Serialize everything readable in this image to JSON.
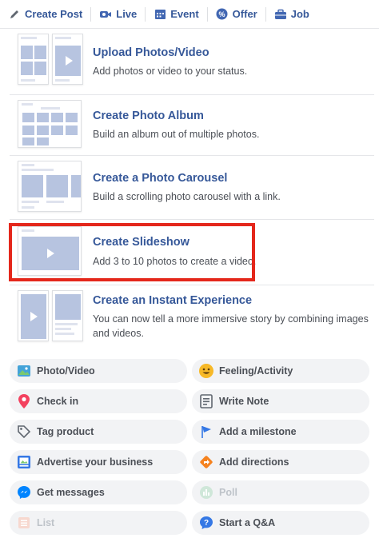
{
  "tabs": [
    {
      "label": "Create Post",
      "icon": "pencil-icon"
    },
    {
      "label": "Live",
      "icon": "video-camera-icon"
    },
    {
      "label": "Event",
      "icon": "calendar-icon"
    },
    {
      "label": "Offer",
      "icon": "offer-tag-icon"
    },
    {
      "label": "Job",
      "icon": "briefcase-icon"
    }
  ],
  "options": [
    {
      "title": "Upload Photos/Video",
      "description": "Add photos or video to your status."
    },
    {
      "title": "Create Photo Album",
      "description": "Build an album out of multiple photos."
    },
    {
      "title": "Create a Photo Carousel",
      "description": "Build a scrolling photo carousel with a link."
    },
    {
      "title": "Create Slideshow",
      "description": "Add 3 to 10 photos to create a video."
    },
    {
      "title": "Create an Instant Experience",
      "description": "You can now tell a more immersive story by combining images and videos."
    }
  ],
  "actions": [
    {
      "label": "Photo/Video",
      "icon": "photo-icon",
      "enabled": true
    },
    {
      "label": "Feeling/Activity",
      "icon": "smiley-icon",
      "enabled": true
    },
    {
      "label": "Check in",
      "icon": "map-pin-icon",
      "enabled": true
    },
    {
      "label": "Write Note",
      "icon": "note-icon",
      "enabled": true
    },
    {
      "label": "Tag product",
      "icon": "price-tag-icon",
      "enabled": true
    },
    {
      "label": "Add a milestone",
      "icon": "flag-icon",
      "enabled": true
    },
    {
      "label": "Advertise your business",
      "icon": "advertise-icon",
      "enabled": true
    },
    {
      "label": "Add directions",
      "icon": "directions-icon",
      "enabled": true
    },
    {
      "label": "Get messages",
      "icon": "messenger-icon",
      "enabled": true
    },
    {
      "label": "Poll",
      "icon": "poll-icon",
      "enabled": false
    },
    {
      "label": "List",
      "icon": "list-icon",
      "enabled": false
    },
    {
      "label": "Start a Q&A",
      "icon": "question-icon",
      "enabled": true
    }
  ],
  "colors": {
    "link": "#365899",
    "highlight": "#e4271b",
    "pill_bg": "#f2f3f5"
  }
}
